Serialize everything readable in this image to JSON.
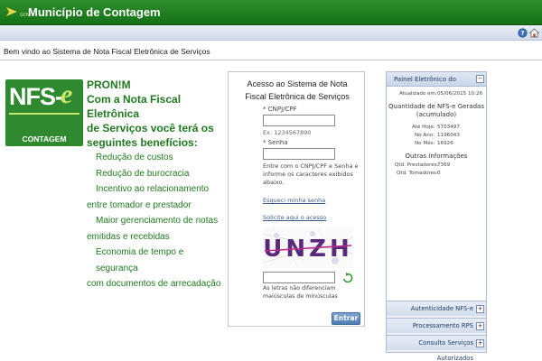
{
  "header": {
    "brand_sub": "GOV",
    "title": "Município de Contagem"
  },
  "toolbar": {
    "help_icon": "help-icon",
    "home_icon": "home-icon"
  },
  "welcome": "Bem vindo ao Sistema de Nota Fiscal Eletrônica de Serviços",
  "logo": {
    "nfs": "NFS-",
    "e": "e",
    "city": "CONTAGEM"
  },
  "promo": {
    "brand": "PRON!M",
    "line1": "Com a Nota Fiscal Eletrônica",
    "line2": "de Serviços você terá os",
    "line3": "seguintes benefícios:",
    "benefits": [
      "Redução de custos",
      "Redução de burocracia",
      "Incentivo ao relacionamento",
      "entre tomador e prestador",
      "Maior gerenciamento de notas",
      "emitidas e recebidas",
      "Economia de tempo e segurança",
      "com documentos de arrecadação"
    ]
  },
  "login": {
    "title_line1": "Acesso ao Sistema de Nota",
    "title_line2": "Fiscal Eletrônica de Serviços",
    "cnpj_label": "* CNPJ/CPF",
    "cnpj_value": "",
    "cnpj_hint": "Ex: 1234567890",
    "password_label": "* Senha",
    "password_value": "",
    "info": "Entre com o CNPJ/CPF e Senha e informe os caracteres exibidos abaixo.",
    "forgot_link": "Esqueci minha senha",
    "request_link": "Solicite aqui o acesso",
    "captcha_text": "UNZH",
    "captcha_value": "",
    "captcha_note": "As letras não diferenciam maiúsculas de minúsculas",
    "submit": "Entrar"
  },
  "panel": {
    "title": "Painel Eletrônico do Município",
    "updated_label": "Atualizado em:",
    "updated_value": "05/06/2015 10:26",
    "nfse_title_line1": "Quantidade de NFS-e Geradas",
    "nfse_title_line2": "(acumulado)",
    "today_label": "Até Hoje:",
    "today_value": "5703497",
    "year_label": "No Ano:",
    "year_value": "1196043",
    "month_label": "No Mês:",
    "month_value": "16926",
    "other_title": "Outras Informações",
    "providers_label": "Qtd. Prestadores:",
    "providers_value": "7369",
    "takers_label": "Qtd. Tomadores:",
    "takers_value": "0",
    "sections": [
      "Autenticidade NFS-e",
      "Processamento RPS",
      "Consulta Serviços Autorizados"
    ]
  }
}
